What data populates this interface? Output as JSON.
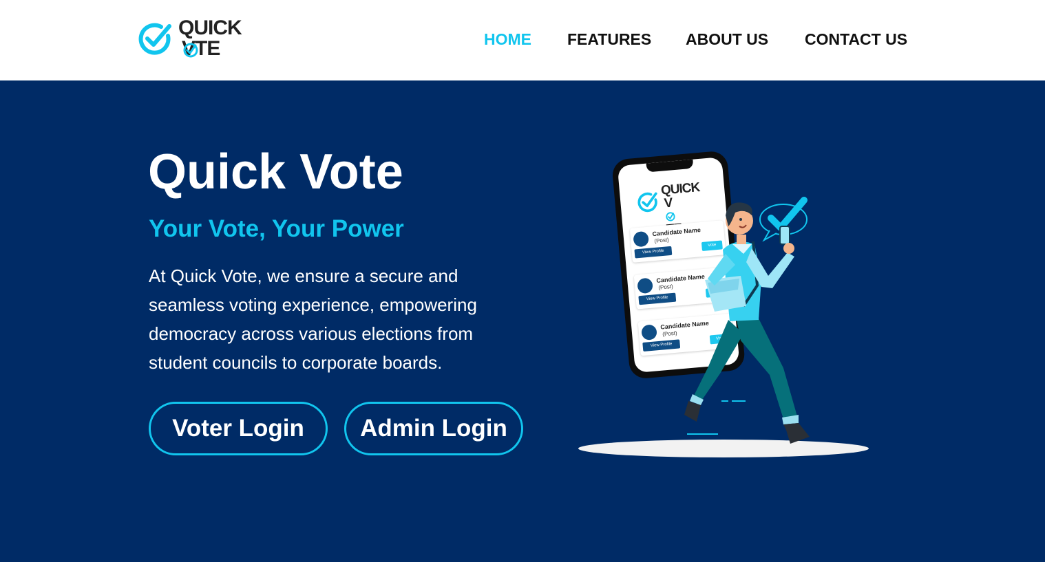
{
  "brand": {
    "line1": "QUICK",
    "line2_pre": "V",
    "line2_post": "TE"
  },
  "nav": {
    "home": "HOME",
    "features": "FEATURES",
    "about": "ABOUT US",
    "contact": "CONTACT US"
  },
  "hero": {
    "title": "Quick Vote",
    "tagline": "Your Vote, Your Power",
    "description": "At Quick Vote, we ensure a secure and seamless voting experience, empowering democracy across various elections from student councils to corporate boards.",
    "voter_login": "Voter Login",
    "admin_login": "Admin Login"
  },
  "phone_mockup": {
    "candidates": [
      {
        "name": "Candidate Name",
        "post": "(Post)",
        "view": "View Profile",
        "vote": "Vote"
      },
      {
        "name": "Candidate Name",
        "post": "(Post)",
        "view": "View Profile",
        "vote": "Vote"
      },
      {
        "name": "Candidate Name",
        "post": "(Post)",
        "view": "View Profile",
        "vote": "Vote"
      }
    ]
  },
  "colors": {
    "accent": "#11c5ee",
    "hero_background": "#002b66",
    "header_background": "#ffffff",
    "nav_text": "#111111"
  }
}
